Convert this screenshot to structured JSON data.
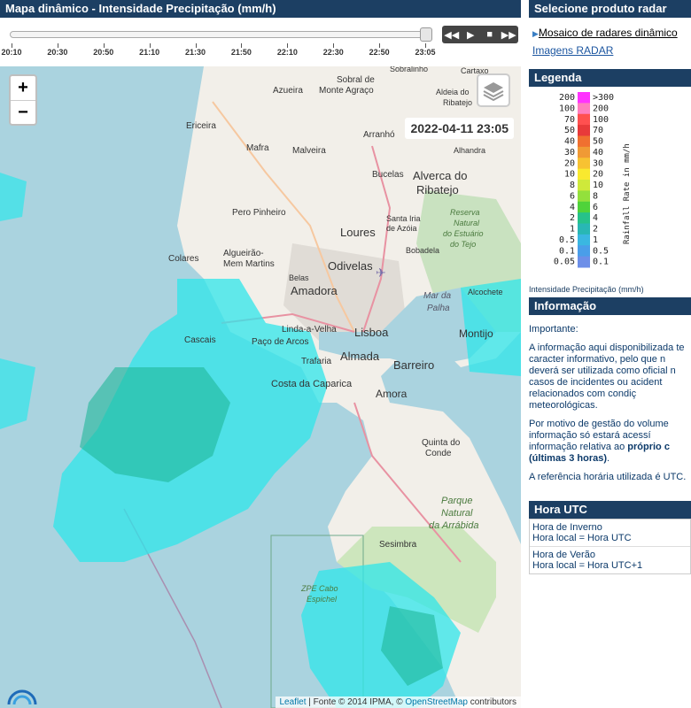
{
  "map_panel": {
    "title": "Mapa dinâmico - Intensidade Precipitação (mm/h)",
    "timeline_ticks": [
      "20:10",
      "20:30",
      "20:50",
      "21:10",
      "21:30",
      "21:50",
      "22:10",
      "22:30",
      "22:50",
      "23:05"
    ],
    "slider_position": 1.0,
    "timestamp": "2022-04-11 23:05",
    "zoom_in_label": "+",
    "zoom_out_label": "−",
    "attribution": {
      "leaflet": "Leaflet",
      "source": " | Fonte © 2014 IPMA, © ",
      "osm": "OpenStreetMap",
      "suffix": " contributors"
    },
    "place_labels": [
      "Azueira",
      "Sobral de Monte Agraço",
      "Sobralinho",
      "Cartaxo",
      "Aldeia do Ribatejo",
      "Ericeira",
      "Arranhó",
      "Mafra",
      "Malveira",
      "Alhandra",
      "Bucelas",
      "Alverca do Ribatejo",
      "Pero Pinheiro",
      "Santa Iria de Azóia",
      "Reserva Natural do Estuário do Tejo",
      "Loures",
      "Bobadela",
      "Algueirão-Mem Martins",
      "Odivelas",
      "Colares",
      "Belas",
      "Amadora",
      "Alcochete",
      "Mar da Palha",
      "Linda-a-Velha",
      "Lisboa",
      "Montijo",
      "Cascais",
      "Paço de Arcos",
      "Trafaria",
      "Almada",
      "Barreiro",
      "Costa da Caparica",
      "Amora",
      "Quinta do Conde",
      "Parque Natural da Arrábida",
      "Sesimbra",
      "ZPE Cabo Espichel"
    ]
  },
  "sidebar": {
    "product_header": "Selecione produto radar",
    "product_links": [
      "Mosaico de radares dinâmico",
      "Imagens RADAR"
    ],
    "legend_header": "Legenda",
    "legend": {
      "left_labels": [
        "200",
        "100",
        "70",
        "50",
        "40",
        "30",
        "20",
        "10",
        "8",
        "6",
        "4",
        "2",
        "1",
        "0.5",
        "0.1",
        "0.05"
      ],
      "right_labels": [
        ">300",
        "200",
        "100",
        "70",
        "50",
        "40",
        "30",
        "20",
        "10",
        "8",
        "6",
        "4",
        "2",
        "1",
        "0.5",
        "0.1"
      ],
      "axis_title": "Rainfall Rate in mm/h",
      "caption": "Intensidade Precipitação (mm/h)",
      "colors": [
        "#ff33ff",
        "#ff7fbf",
        "#ff5050",
        "#e83a3a",
        "#f07030",
        "#f09a35",
        "#f7c232",
        "#f9e92f",
        "#cfe93a",
        "#93e03c",
        "#4fd33a",
        "#26c28a",
        "#29b7b4",
        "#3ab7e1",
        "#4a9ee9",
        "#6d8fe8"
      ]
    },
    "info_header": "Informação",
    "info_important": "Importante",
    "info_lines_1": [
      "A informação aqui disponibilizada te",
      "caracter informativo, pelo que n",
      "deverá ser utilizada como oficial n",
      "casos de incidentes ou acident",
      "relacionados com condiç",
      "meteorológicas."
    ],
    "info_lines_2_a": "Por motivo de gestão do volume",
    "info_lines_2_b": "informação só estará acessí",
    "info_lines_2_c": "informação relativa ao ",
    "info_lines_2_c_bold": "próprio c",
    "info_lines_2_d": "(últimas 3 horas)",
    "info_lines_2_d_tail": ".",
    "info_utc": "A referência horária utilizada é UTC.",
    "hora_header": "Hora UTC",
    "hora_inverno": [
      "Hora de Inverno",
      "Hora local = Hora UTC"
    ],
    "hora_verao": [
      "Hora de Verão",
      "Hora local = Hora UTC+1"
    ]
  }
}
